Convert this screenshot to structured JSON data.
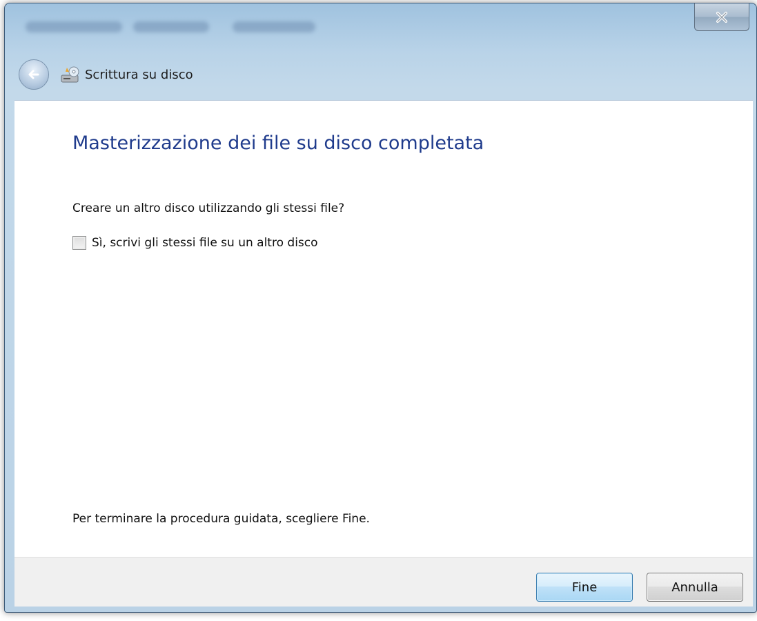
{
  "window": {
    "title": "Scrittura su disco",
    "close_label": "x"
  },
  "icons": {
    "back": "back-arrow-icon",
    "wizard": "disc-burner-icon",
    "close": "close-icon"
  },
  "main": {
    "heading": "Masterizzazione dei file su disco completata",
    "question": "Creare un altro disco utilizzando gli stessi file?",
    "checkbox_label": "Sì, scrivi gli stessi file su un altro disco",
    "checkbox_checked": false,
    "hint": "Per terminare la procedura guidata, scegliere Fine."
  },
  "footer": {
    "finish_label": "Fine",
    "cancel_label": "Annulla"
  },
  "colors": {
    "heading": "#1f3b8c",
    "frame": "#bad2e6",
    "footer": "#f0f0f0",
    "primary_button_border": "#3c7fb1"
  }
}
